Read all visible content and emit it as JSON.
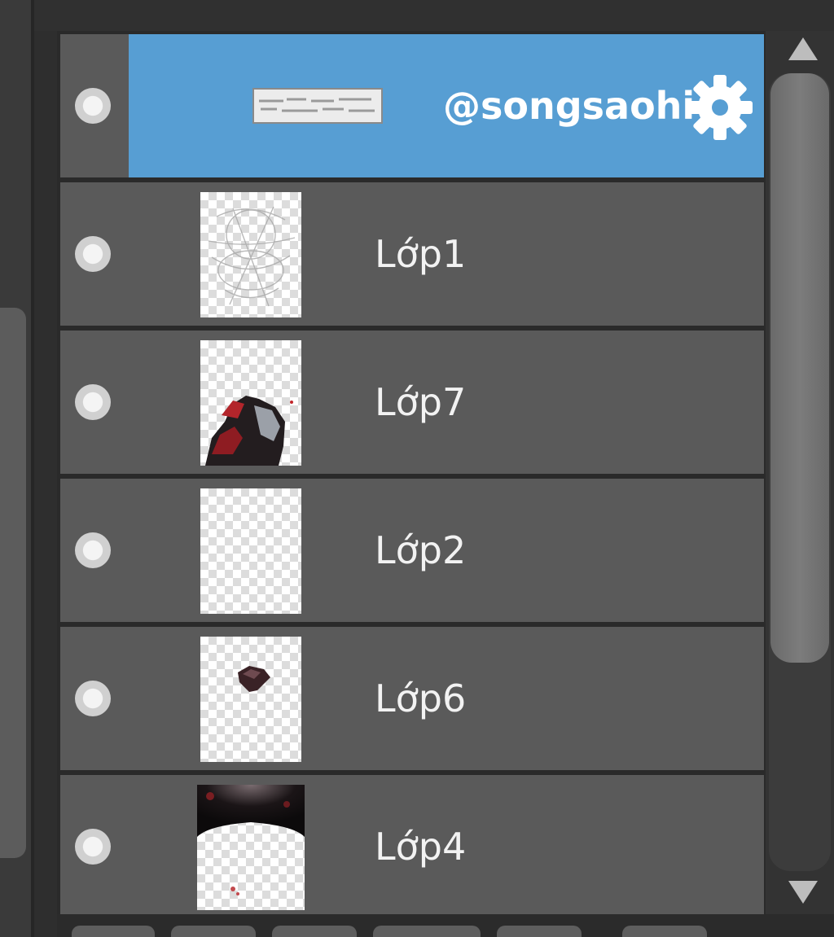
{
  "layers_panel": {
    "layers": [
      {
        "name": "@songsaohi",
        "selected": true,
        "thumbnail": "text-watermark-strip",
        "settings_icon": "gear-icon"
      },
      {
        "name": "Lớp1",
        "selected": false,
        "thumbnail": "sketch-lines"
      },
      {
        "name": "Lớp7",
        "selected": false,
        "thumbnail": "figure-dark-red"
      },
      {
        "name": "Lớp2",
        "selected": false,
        "thumbnail": "empty-transparent"
      },
      {
        "name": "Lớp6",
        "selected": false,
        "thumbnail": "small-dark-shape"
      },
      {
        "name": "Lớp4",
        "selected": false,
        "thumbnail": "dark-top-gradient"
      }
    ]
  },
  "colors": {
    "selected_row": "#579ed3",
    "row": "#5a5a5a",
    "text": "#f2f2f2"
  },
  "icons": {
    "visibility": "visibility-dot-icon",
    "scroll_up": "triangle-up-icon",
    "scroll_down": "triangle-down-icon",
    "settings": "gear-icon"
  }
}
